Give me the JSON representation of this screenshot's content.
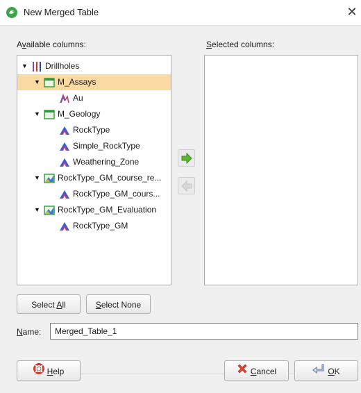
{
  "window": {
    "title": "New Merged Table",
    "close": "✕"
  },
  "available_label": "Available columns:",
  "selected_label": "Selected columns:",
  "tree": [
    {
      "label": "Drillholes",
      "icon": "drillholes-icon",
      "level": 0,
      "expanded": true,
      "selected": false
    },
    {
      "label": "M_Assays",
      "icon": "table-icon",
      "level": 1,
      "expanded": true,
      "selected": true
    },
    {
      "label": "Au",
      "icon": "numeric-column-icon",
      "level": 2,
      "expanded": false,
      "selected": false
    },
    {
      "label": "M_Geology",
      "icon": "table-icon",
      "level": 1,
      "expanded": true,
      "selected": false
    },
    {
      "label": "RockType",
      "icon": "category-column-icon",
      "level": 2,
      "expanded": false,
      "selected": false
    },
    {
      "label": "Simple_RockType",
      "icon": "category-column-icon",
      "level": 2,
      "expanded": false,
      "selected": false
    },
    {
      "label": "Weathering_Zone",
      "icon": "category-column-icon",
      "level": 2,
      "expanded": false,
      "selected": false
    },
    {
      "label": "RockType_GM_course_re...",
      "icon": "model-table-icon",
      "level": 1,
      "expanded": true,
      "selected": false
    },
    {
      "label": "RockType_GM_cours...",
      "icon": "category-column-icon",
      "level": 2,
      "expanded": false,
      "selected": false
    },
    {
      "label": "RockType_GM_Evaluation",
      "icon": "model-table-icon",
      "level": 1,
      "expanded": true,
      "selected": false
    },
    {
      "label": "RockType_GM",
      "icon": "category-column-icon",
      "level": 2,
      "expanded": false,
      "selected": false
    }
  ],
  "buttons": {
    "add": "add-arrow-icon",
    "remove": "remove-arrow-icon",
    "select_all": "Select All",
    "select_none": "Select None",
    "help": "Help",
    "cancel": "Cancel",
    "ok": "OK"
  },
  "name_field": {
    "label": "Name:",
    "value": "Merged_Table_1"
  },
  "colors": {
    "selection": "#fbd9a2",
    "table_icon": "#2e9a3a",
    "drillhole_icon": "#8e44ad",
    "add_arrow": "#5cb82e",
    "remove_arrow": "#c9c9c9"
  }
}
